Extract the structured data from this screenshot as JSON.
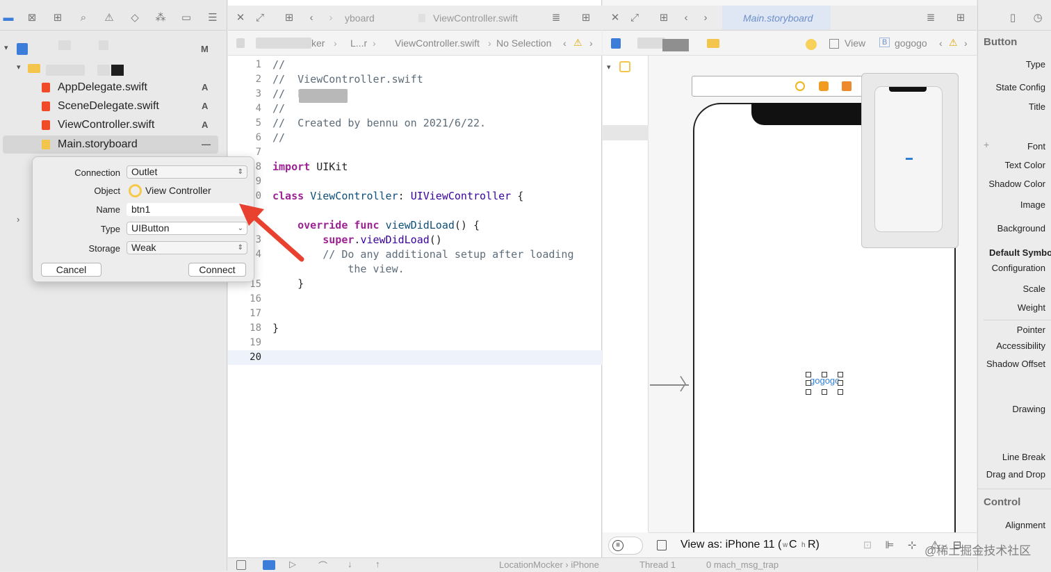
{
  "navigator": {
    "project_status": "M",
    "files": [
      {
        "name": "AppDelegate.swift",
        "badge": "A"
      },
      {
        "name": "SceneDelegate.swift",
        "badge": "A"
      },
      {
        "name": "ViewController.swift",
        "badge": "A"
      },
      {
        "name": "Main.storyboard",
        "badge": "—"
      }
    ]
  },
  "popover": {
    "connection_label": "Connection",
    "connection_value": "Outlet",
    "object_label": "Object",
    "object_value": "View Controller",
    "name_label": "Name",
    "name_value": "btn1",
    "type_label": "Type",
    "type_value": "UIButton",
    "storage_label": "Storage",
    "storage_value": "Weak",
    "cancel_label": "Cancel",
    "connect_label": "Connect"
  },
  "editor": {
    "tab_left": "yboard",
    "tab_active": "ViewController.swift",
    "jump": [
      "ker",
      "L...r",
      "ViewController.swift",
      "No Selection"
    ],
    "line_numbers": [
      "1",
      "2",
      "3",
      "4",
      "5",
      "6",
      "7",
      "8",
      "9",
      "0",
      "",
      "3",
      "4",
      "",
      "15",
      "16",
      "17",
      "18",
      "19",
      "20"
    ],
    "lines": [
      "//",
      "//  ViewController.swift",
      "//  L",
      "//",
      "//  Created by bennu on 2021/6/22.",
      "//",
      "",
      "import UIKit",
      "",
      "class ViewController: UIViewController {",
      "",
      "    override func viewDidLoad() {",
      "        super.viewDidLoad()",
      "        // Do any additional setup after loading",
      "            the view.",
      "    }",
      "",
      "",
      "}",
      ""
    ]
  },
  "canvas": {
    "tab_title": "Main.storyboard",
    "jump_view": "View",
    "jump_button": "gogogo",
    "button_text": "gogogo",
    "view_as": "View as: iPhone 11 (",
    "view_as_w": "w",
    "view_as_c": "C",
    "view_as_h": "h",
    "view_as_r": "R)"
  },
  "inspector": {
    "section_button": "Button",
    "labels": [
      "Type",
      "State Config",
      "Title",
      "Font",
      "Text Color",
      "Shadow Color",
      "Image",
      "Background",
      "Default Symbo",
      "Configuration",
      "Scale",
      "Weight",
      "Pointer",
      "Accessibility",
      "Shadow Offset",
      "Drawing",
      "Line Break",
      "Drag and Drop",
      "Alignment"
    ],
    "section_control": "Control"
  },
  "debug_bar": {
    "target": "LocationMocker › iPhone",
    "thread": "Thread 1",
    "frame": "0 mach_msg_trap"
  },
  "watermark": "@稀土掘金技术社区",
  "colors": {
    "accent": "#2f7fd8",
    "keyword": "#9b2393",
    "arrow": "#e8412f"
  }
}
